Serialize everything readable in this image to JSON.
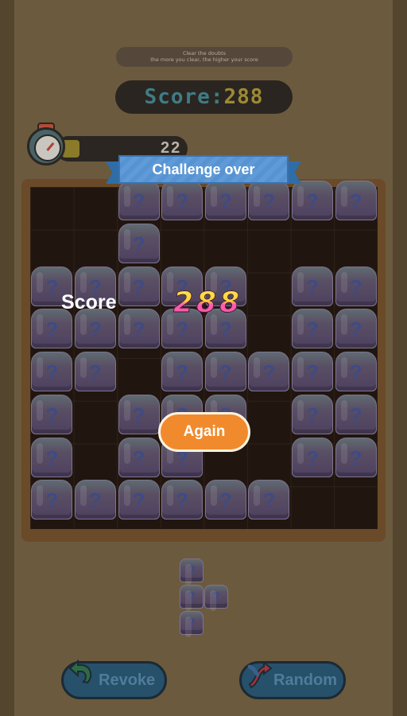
{
  "hint": {
    "line1": "Clear the doubts",
    "line2": "the more you clear, the higher your score"
  },
  "score_bar": {
    "label": "Score:",
    "value": "288"
  },
  "timer": {
    "value": "22"
  },
  "banner": {
    "title": "Challenge over"
  },
  "result": {
    "label": "Score",
    "value": "288"
  },
  "buttons": {
    "again": "Again",
    "revoke": "Revoke",
    "random": "Random"
  },
  "tile_symbol": "?",
  "colors": {
    "again": "#f08a2c",
    "banner": "#5f9bd8",
    "board": "#21160f",
    "frame": "#6a4a28"
  }
}
